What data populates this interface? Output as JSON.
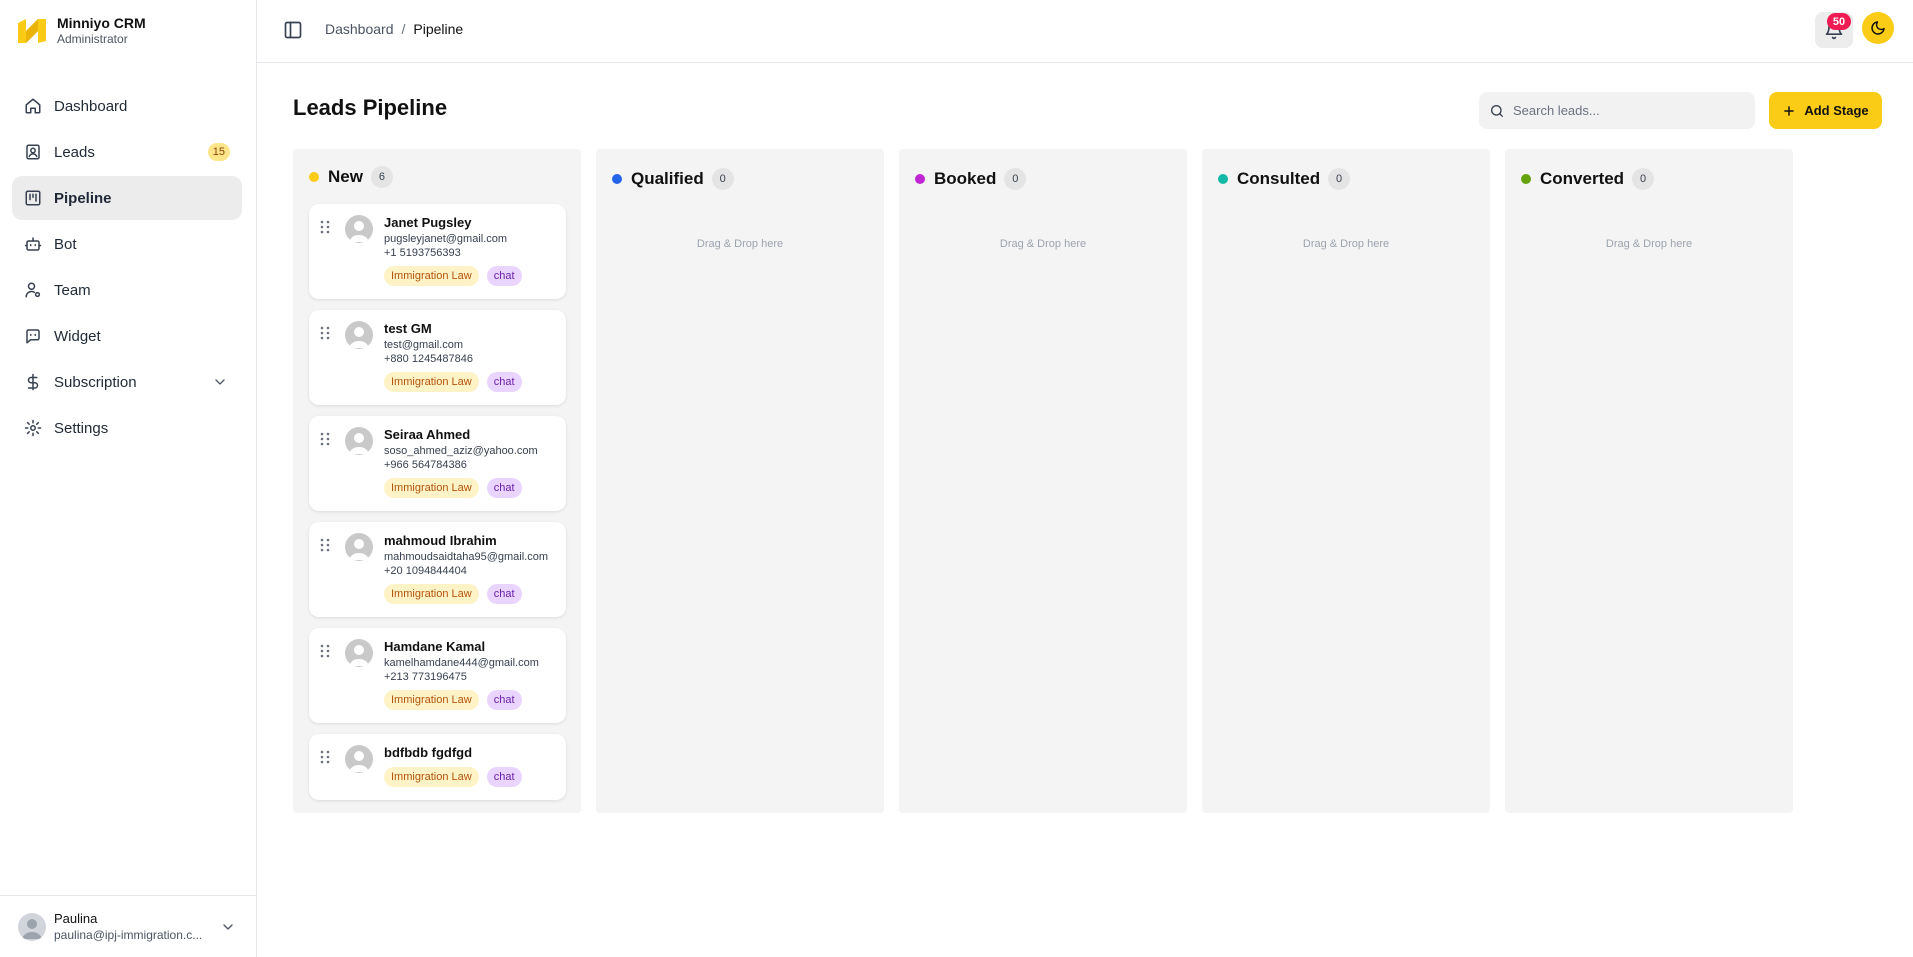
{
  "brand": {
    "name": "Minniyo CRM",
    "role": "Administrator"
  },
  "nav": [
    {
      "label": "Dashboard",
      "icon": "home-icon"
    },
    {
      "label": "Leads",
      "icon": "contact-icon",
      "badge": "15"
    },
    {
      "label": "Pipeline",
      "icon": "kanban-icon",
      "active": true
    },
    {
      "label": "Bot",
      "icon": "bot-icon"
    },
    {
      "label": "Team",
      "icon": "user-gear-icon"
    },
    {
      "label": "Widget",
      "icon": "widget-icon"
    },
    {
      "label": "Subscription",
      "icon": "dollar-icon",
      "expandable": true
    },
    {
      "label": "Settings",
      "icon": "gear-icon"
    }
  ],
  "user": {
    "name": "Paulina",
    "email": "paulina@ipj-immigration.c..."
  },
  "header": {
    "breadcrumb": {
      "root": "Dashboard",
      "separator": "/",
      "current": "Pipeline"
    },
    "notifications": "50"
  },
  "main": {
    "title": "Leads Pipeline",
    "search_placeholder": "Search leads...",
    "add_stage_label": "Add Stage"
  },
  "colors": {
    "accent": "#facc15",
    "stage_new": "#facc15",
    "stage_qualified": "#2563eb",
    "stage_booked": "#c026d3",
    "stage_consulted": "#14b8a6",
    "stage_converted": "#65a30d"
  },
  "stages": [
    {
      "name": "New",
      "count": "6"
    },
    {
      "name": "Qualified",
      "count": "0",
      "empty_text": "Drag & Drop here"
    },
    {
      "name": "Booked",
      "count": "0",
      "empty_text": "Drag & Drop here"
    },
    {
      "name": "Consulted",
      "count": "0",
      "empty_text": "Drag & Drop here"
    },
    {
      "name": "Converted",
      "count": "0",
      "empty_text": "Drag & Drop here"
    }
  ],
  "leads": [
    {
      "name": "Janet Pugsley",
      "email": "pugsleyjanet@gmail.com",
      "phone": "+1 5193756393",
      "area": "Immigration Law",
      "source": "chat"
    },
    {
      "name": "test GM",
      "email": "test@gmail.com",
      "phone": "+880 1245487846",
      "area": "Immigration Law",
      "source": "chat"
    },
    {
      "name": "Seiraa Ahmed",
      "email": "soso_ahmed_aziz@yahoo.com",
      "phone": "+966 564784386",
      "area": "Immigration Law",
      "source": "chat"
    },
    {
      "name": "mahmoud Ibrahim",
      "email": "mahmoudsaidtaha95@gmail.com",
      "phone": "+20 1094844404",
      "area": "Immigration Law",
      "source": "chat"
    },
    {
      "name": "Hamdane Kamal",
      "email": "kamelhamdane444@gmail.com",
      "phone": "+213 773196475",
      "area": "Immigration Law",
      "source": "chat"
    },
    {
      "name": "bdfbdb fgdfgd",
      "area": "Immigration Law",
      "source": "chat"
    }
  ]
}
